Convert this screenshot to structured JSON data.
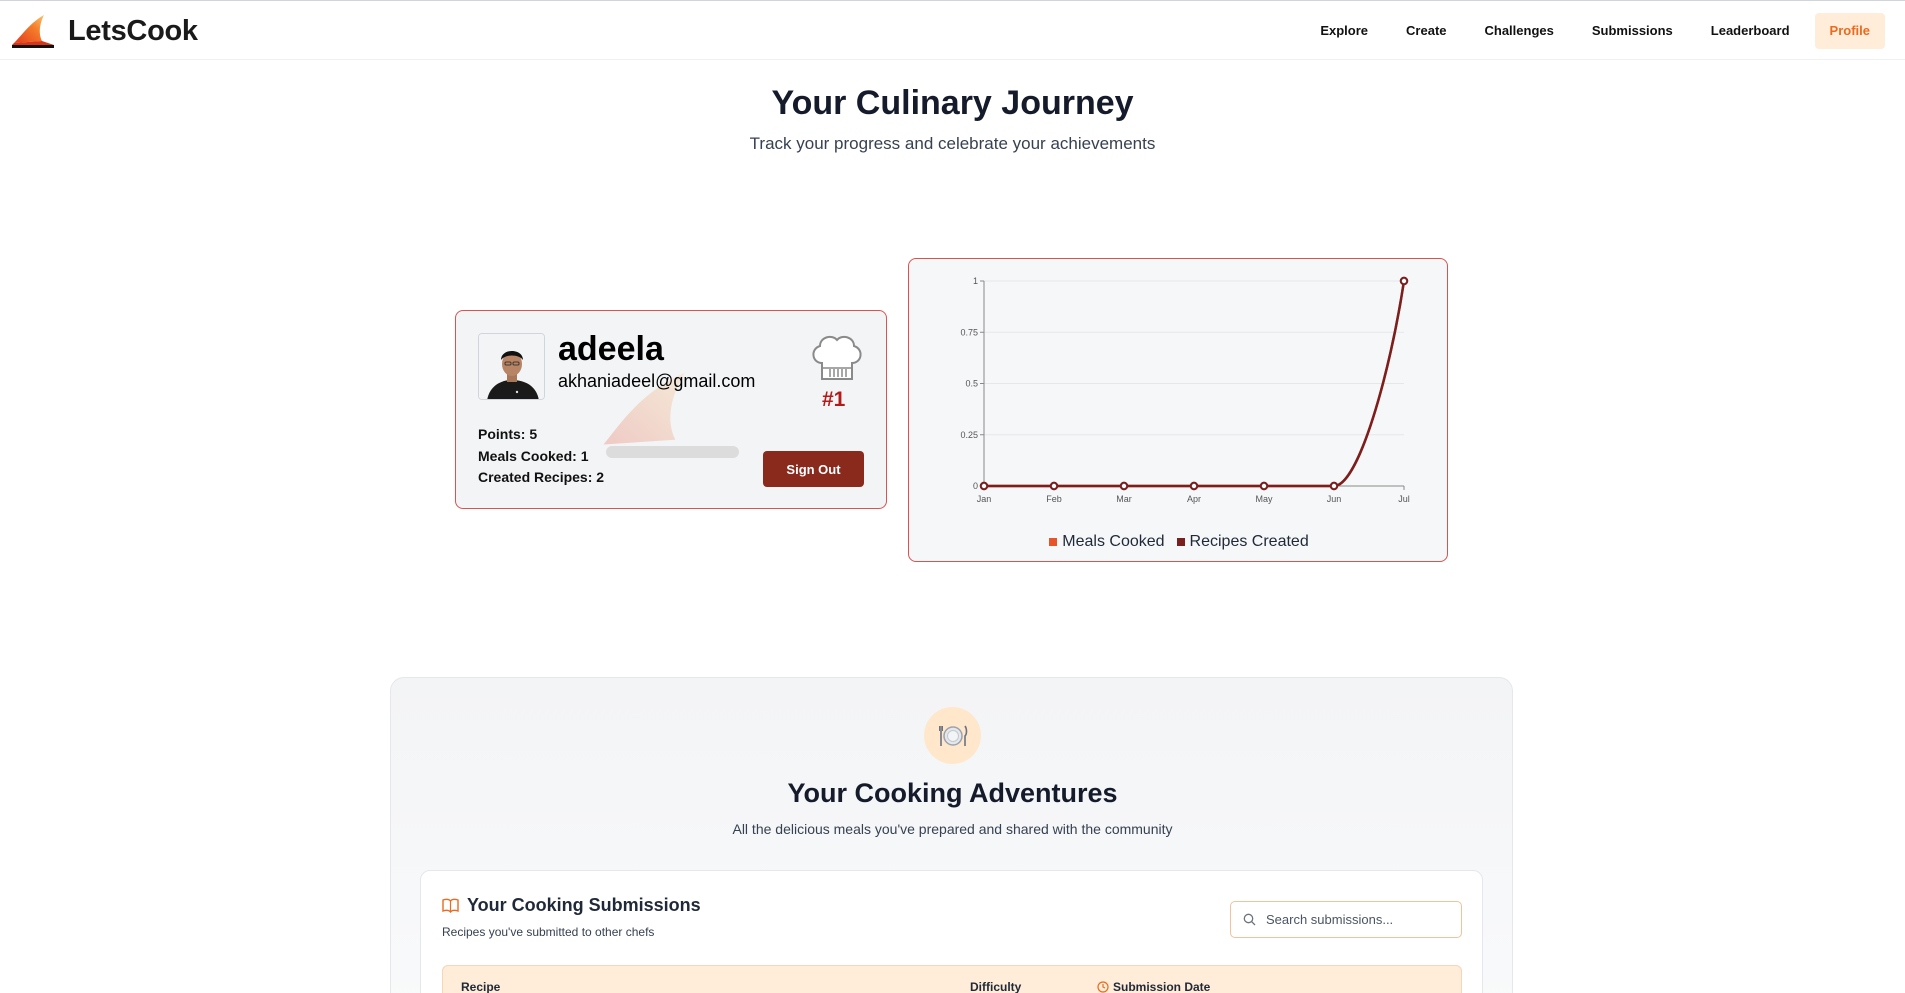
{
  "brand": {
    "name": "LetsCook"
  },
  "nav": {
    "items": [
      {
        "label": "Explore",
        "active": false
      },
      {
        "label": "Create",
        "active": false
      },
      {
        "label": "Challenges",
        "active": false
      },
      {
        "label": "Submissions",
        "active": false
      },
      {
        "label": "Leaderboard",
        "active": false
      },
      {
        "label": "Profile",
        "active": true
      }
    ]
  },
  "hero": {
    "title": "Your Culinary Journey",
    "subtitle": "Track your progress and celebrate your achievements"
  },
  "profile": {
    "username": "adeela",
    "email": "akhaniadeel@gmail.com",
    "rank": "#1",
    "points_label": "Points: 5",
    "meals_label": "Meals Cooked: 1",
    "recipes_label": "Created Recipes: 2",
    "progress_percent": 0,
    "signout_label": "Sign Out"
  },
  "chart_data": {
    "type": "line",
    "categories": [
      "Jan",
      "Feb",
      "Mar",
      "Apr",
      "May",
      "Jun",
      "Jul"
    ],
    "yticks": [
      "0",
      "0.25",
      "0.5",
      "0.75",
      "1"
    ],
    "ylim": [
      0,
      1
    ],
    "grid": true,
    "legend_position": "bottom",
    "series": [
      {
        "name": "Meals Cooked",
        "color": "#e8542a",
        "values": [
          0,
          0,
          0,
          0,
          0,
          0,
          1
        ]
      },
      {
        "name": "Recipes Created",
        "color": "#7a1f1f",
        "values": [
          0,
          0,
          0,
          0,
          0,
          0,
          1
        ]
      }
    ]
  },
  "adventures": {
    "title": "Your Cooking Adventures",
    "subtitle": "All the delicious meals you've prepared and shared with the community"
  },
  "submissions": {
    "title": "Your Cooking Submissions",
    "description": "Recipes you've submitted to other chefs",
    "search_placeholder": "Search submissions...",
    "columns": [
      "Recipe",
      "Difficulty",
      "Submission Date"
    ]
  },
  "colors": {
    "accent": "#ea6a1f",
    "card_border": "#d9534f",
    "signout": "#8a2a1d",
    "rank": "#b31b1b"
  }
}
